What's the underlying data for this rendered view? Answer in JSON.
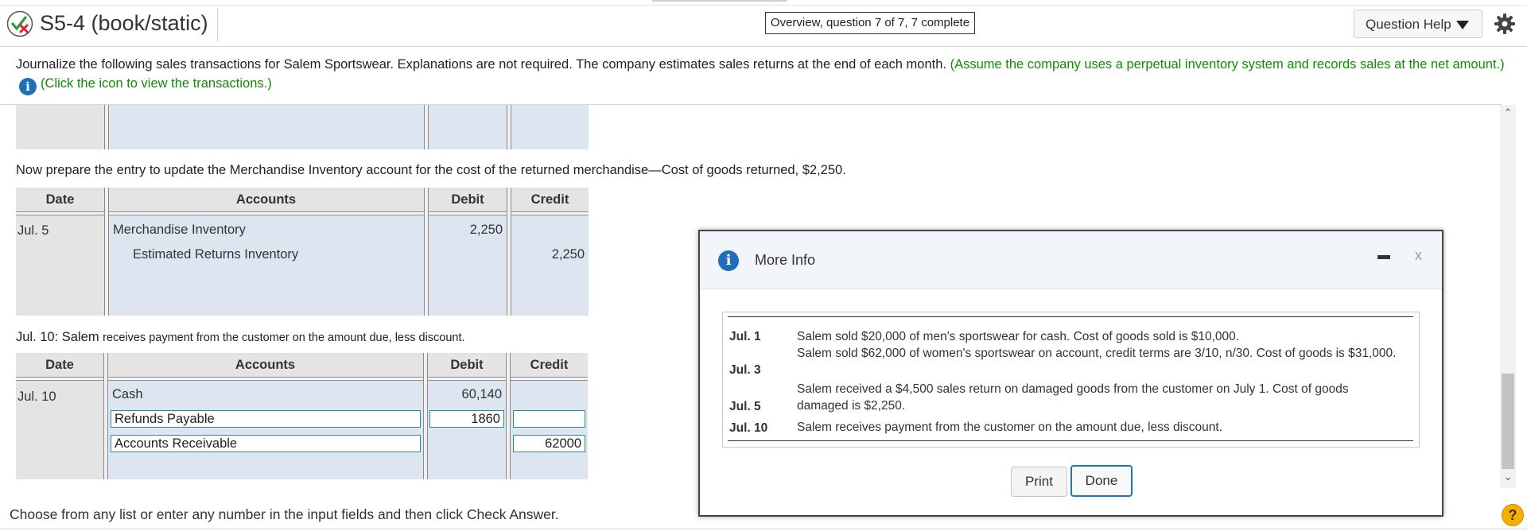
{
  "header": {
    "title": "S5-4 (book/static)",
    "overview": "Overview, question 7 of 7, 7 complete",
    "question_help": "Question Help"
  },
  "instructions": {
    "main": "Journalize the following sales transactions for Salem Sportswear. Explanations are not required. The company estimates sales returns at the end of each month.",
    "assumption": "(Assume the company uses a perpetual inventory system and records sales at the net amount.)",
    "click_icon": "(Click the icon to view the transactions.)"
  },
  "table_headers": {
    "date": "Date",
    "accounts": "Accounts",
    "debit": "Debit",
    "credit": "Credit"
  },
  "entry_returns": {
    "prompt": "Now prepare the entry to update the Merchandise Inventory account for the cost of the returned merchandise—Cost of goods returned, $2,250.",
    "date": "Jul. 5",
    "rows": [
      {
        "account": "Merchandise Inventory",
        "debit": "2,250",
        "credit": ""
      },
      {
        "account": "Estimated Returns Inventory",
        "debit": "",
        "credit": "2,250"
      }
    ]
  },
  "entry_payment": {
    "prompt_date": "Jul. 10:",
    "prompt_salem": "Salem",
    "prompt_rest": "receives payment from the customer on the amount due, less discount.",
    "date": "Jul. 10",
    "rows": [
      {
        "account": "Cash",
        "debit": "60,140",
        "credit": ""
      },
      {
        "account": "Refunds Payable",
        "debit": "1860",
        "credit": ""
      },
      {
        "account": "Accounts Receivable",
        "debit": "",
        "credit": "62000"
      }
    ]
  },
  "footer": {
    "text": "Choose from any list or enter any number in the input fields and then click Check Answer."
  },
  "modal": {
    "title": "More Info",
    "close": "x",
    "transactions": [
      {
        "date": "Jul. 1",
        "desc": "Salem sold $20,000 of men's sportswear for cash. Cost of goods sold is $10,000."
      },
      {
        "date": "Jul. 3",
        "desc": "Salem sold $62,000 of women's sportswear on account, credit terms are 3/10, n/30. Cost of goods is $31,000."
      },
      {
        "date": "Jul. 5",
        "desc": "Salem received a $4,500 sales return on damaged goods from the customer on July 1. Cost of goods damaged is $2,250."
      },
      {
        "date": "Jul. 10",
        "desc": "Salem receives payment from the customer on the amount due, less discount."
      }
    ],
    "print": "Print",
    "done": "Done"
  },
  "icons": {
    "status": "partial-correct-icon",
    "info": "info-icon",
    "settings": "gear-icon",
    "help": "help-icon"
  },
  "colors": {
    "instruction_green": "#138a06",
    "table_cell": "#dde5f0",
    "info_blue": "#1f6fb8",
    "done_border": "#1b74c7",
    "help_yellow": "#f5b000"
  }
}
